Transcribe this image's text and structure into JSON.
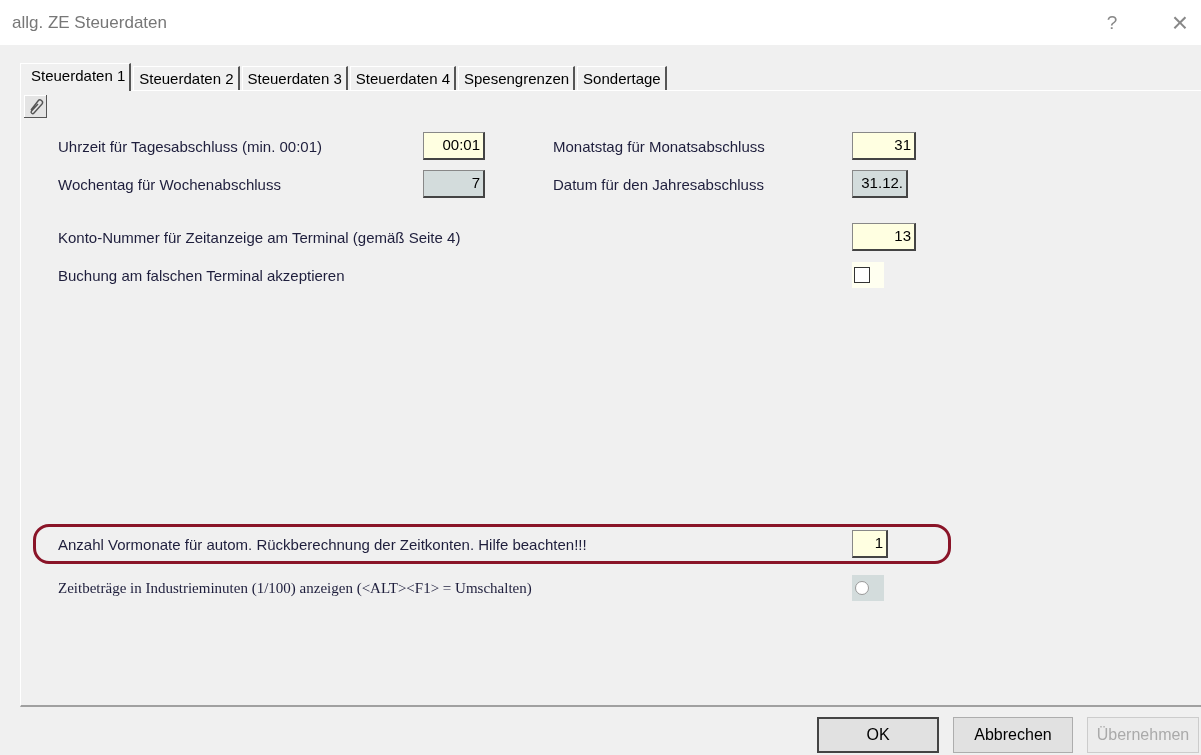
{
  "window": {
    "title": "allg. ZE Steuerdaten",
    "help_button": "?",
    "close_button": "×"
  },
  "tabs": [
    {
      "label": "Steuerdaten 1",
      "selected": true
    },
    {
      "label": "Steuerdaten 2",
      "selected": false
    },
    {
      "label": "Steuerdaten 3",
      "selected": false
    },
    {
      "label": "Steuerdaten 4",
      "selected": false
    },
    {
      "label": "Spesengrenzen",
      "selected": false
    },
    {
      "label": "Sondertage",
      "selected": false
    }
  ],
  "top_fields": [
    {
      "label": "Uhrzeit für Tagesabschluss (min. 00:01)",
      "value": "00:01",
      "disabled": false
    },
    {
      "label": "Monatstag für Monatsabschluss",
      "value": "31",
      "disabled": false
    },
    {
      "label": "Wochentag für Wochenabschluss",
      "value": "7",
      "disabled": true
    },
    {
      "label": "Datum für den Jahresabschluss",
      "value": "31.12.",
      "disabled": true
    }
  ],
  "options": [
    {
      "kind": "field",
      "label": "Konto-Nummer für Zeitanzeige am Terminal (gemäß Seite 4)",
      "value": "13",
      "highlighted": false
    },
    {
      "kind": "checkbox",
      "label": "Buchung am falschen Terminal akzeptieren",
      "checked": false,
      "highlighted": false
    },
    {
      "kind": "spacer"
    },
    {
      "kind": "field",
      "label": "Anzahl Vormonate für autom. Rückberechnung der Zeitkonten. Hilfe beachten!!!",
      "value": "1",
      "highlighted": true
    },
    {
      "kind": "radio",
      "label": "Zeitbeträge in Industrieminuten (1/100) anzeigen (<ALT><F1> = Umschalten)",
      "on": false,
      "highlighted": false
    }
  ],
  "buttons": [
    {
      "label": "OK",
      "default": true,
      "disabled": false
    },
    {
      "label": "Abbrechen",
      "default": false,
      "disabled": false
    },
    {
      "label": "Übernehmen",
      "default": false,
      "disabled": true
    }
  ]
}
